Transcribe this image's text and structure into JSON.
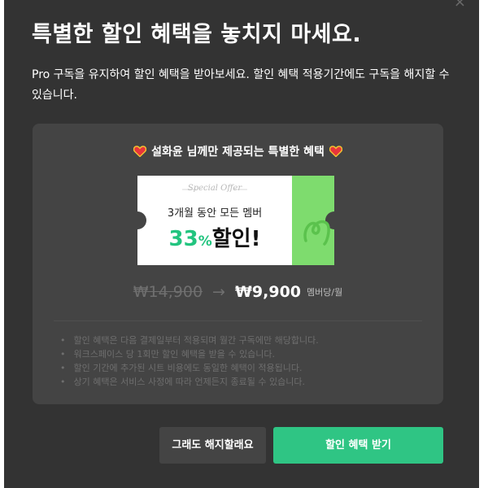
{
  "modal": {
    "close_glyph": "×",
    "title": "특별한 할인 혜택을 놓치지 마세요.",
    "description": "Pro 구독을 유지하여 할인 혜택을 받아보세요. 할인 혜택 적용기간에도 구독을 해지할 수 있습니다."
  },
  "panel": {
    "benefit_title": "설화윤 님께만 제공되는 특별한 혜택",
    "icons": [
      "heart-icon",
      "heart-icon"
    ],
    "ticket": {
      "label": "Special Offer",
      "line": "3개월 동안 모든 멤버",
      "discount_number": "33",
      "discount_percent": "%",
      "discount_text": "할인!"
    },
    "price": {
      "old": "₩14,900",
      "arrow": "→",
      "new": "₩9,900",
      "unit": "멤버당/월"
    },
    "notes": [
      "할인 혜택은 다음 결제일부터 적용되며 월간 구독에만 해당합니다.",
      "워크스페이스 당 1회만 할인 혜택을 받을 수 있습니다.",
      "할인 기간에 추가된 시트 비용에도 동일한 혜택이 적용됩니다.",
      "상기 혜택은 서비스 사정에 따라 언제든지 종료될 수 있습니다."
    ]
  },
  "buttons": {
    "cancel_label": "그래도 해지할래요",
    "accept_label": "할인 혜택 받기"
  },
  "colors": {
    "modal_bg": "#333333",
    "panel_bg": "#444444",
    "accent_green": "#2fc584",
    "ticket_green": "#7edc6e",
    "heart_red": "#e8353b",
    "heart_gold": "#f4c430"
  }
}
